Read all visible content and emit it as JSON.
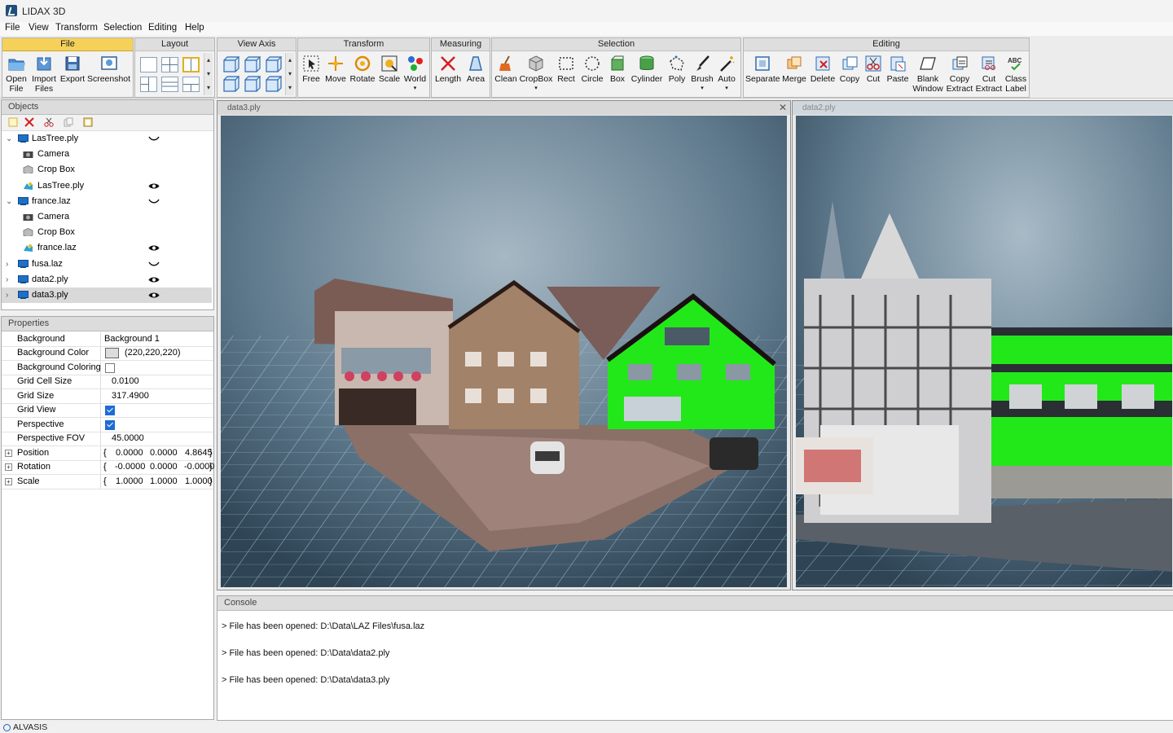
{
  "app": {
    "title": "LIDAX 3D",
    "status": "ALVASIS"
  },
  "menu": [
    "File",
    "View",
    "Transform",
    "Selection",
    "Editing",
    "Help"
  ],
  "ribbon": {
    "file": {
      "title": "File",
      "buttons": [
        {
          "l1": "Open",
          "l2": "File"
        },
        {
          "l1": "Import",
          "l2": "Files"
        },
        {
          "l1": "Export",
          "l2": ""
        },
        {
          "l1": "Screenshot",
          "l2": ""
        }
      ]
    },
    "layout": {
      "title": "Layout"
    },
    "view_axis": {
      "title": "View Axis"
    },
    "transform": {
      "title": "Transform",
      "buttons": [
        {
          "l1": "Free",
          "l2": ""
        },
        {
          "l1": "Move",
          "l2": ""
        },
        {
          "l1": "Rotate",
          "l2": ""
        },
        {
          "l1": "Scale",
          "l2": ""
        },
        {
          "l1": "World",
          "l2": ""
        }
      ]
    },
    "measuring": {
      "title": "Measuring",
      "buttons": [
        {
          "l1": "Length",
          "l2": ""
        },
        {
          "l1": "Area",
          "l2": ""
        }
      ]
    },
    "selection": {
      "title": "Selection",
      "buttons": [
        {
          "l1": "Clean",
          "l2": ""
        },
        {
          "l1": "CropBox",
          "l2": ""
        },
        {
          "l1": "Rect",
          "l2": ""
        },
        {
          "l1": "Circle",
          "l2": ""
        },
        {
          "l1": "Box",
          "l2": ""
        },
        {
          "l1": "Cylinder",
          "l2": ""
        },
        {
          "l1": "Poly",
          "l2": ""
        },
        {
          "l1": "Brush",
          "l2": ""
        },
        {
          "l1": "Auto",
          "l2": ""
        }
      ]
    },
    "editing": {
      "title": "Editing",
      "buttons": [
        {
          "l1": "Separate",
          "l2": ""
        },
        {
          "l1": "Merge",
          "l2": ""
        },
        {
          "l1": "Delete",
          "l2": ""
        },
        {
          "l1": "Copy",
          "l2": ""
        },
        {
          "l1": "Cut",
          "l2": ""
        },
        {
          "l1": "Paste",
          "l2": ""
        },
        {
          "l1": "Blank",
          "l2": "Window"
        },
        {
          "l1": "Copy",
          "l2": "Extract"
        },
        {
          "l1": "Cut",
          "l2": "Extract"
        },
        {
          "l1": "Class",
          "l2": "Label"
        }
      ]
    }
  },
  "objects": {
    "title": "Objects",
    "tree": [
      {
        "label": "LasTree.ply",
        "level": 0,
        "expanded": true,
        "icon": "cloud-file-icon",
        "eye": "closed"
      },
      {
        "label": "Camera",
        "level": 1,
        "icon": "camera-icon",
        "eye": ""
      },
      {
        "label": "Crop Box",
        "level": 1,
        "icon": "cube-icon",
        "eye": ""
      },
      {
        "label": "LasTree.ply",
        "level": 1,
        "icon": "pointcloud-icon",
        "eye": "open"
      },
      {
        "label": "france.laz",
        "level": 0,
        "expanded": true,
        "icon": "cloud-file-icon",
        "eye": "closed"
      },
      {
        "label": "Camera",
        "level": 1,
        "icon": "camera-icon",
        "eye": ""
      },
      {
        "label": "Crop Box",
        "level": 1,
        "icon": "cube-icon",
        "eye": ""
      },
      {
        "label": "france.laz",
        "level": 1,
        "icon": "pointcloud-icon",
        "eye": "open"
      },
      {
        "label": "fusa.laz",
        "level": 0,
        "expanded": false,
        "icon": "cloud-file-icon",
        "eye": "closed"
      },
      {
        "label": "data2.ply",
        "level": 0,
        "expanded": false,
        "icon": "cloud-file-icon",
        "eye": "open"
      },
      {
        "label": "data3.ply",
        "level": 0,
        "expanded": false,
        "icon": "cloud-file-icon",
        "eye": "open",
        "selected": true
      }
    ]
  },
  "properties": {
    "title": "Properties",
    "rows": [
      {
        "name": "Background",
        "value": "Background 1",
        "type": "text"
      },
      {
        "name": "Background Color",
        "value": "(220,220,220)",
        "type": "color",
        "swatch": "#dcdcdc"
      },
      {
        "name": "Background Coloring",
        "value": false,
        "type": "check"
      },
      {
        "name": "Grid Cell Size",
        "value": "0.0100",
        "type": "text"
      },
      {
        "name": "Grid Size",
        "value": "317.4900",
        "type": "text"
      },
      {
        "name": "Grid View",
        "value": true,
        "type": "check"
      },
      {
        "name": "Perspective",
        "value": true,
        "type": "check"
      },
      {
        "name": "Perspective FOV",
        "value": "45.0000",
        "type": "text"
      },
      {
        "name": "Position",
        "type": "vec",
        "v": [
          "0.0000",
          "0.0000",
          "4.8645"
        ]
      },
      {
        "name": "Rotation",
        "type": "vec",
        "v": [
          "-0.0000",
          "0.0000",
          "-0.0000"
        ]
      },
      {
        "name": "Scale",
        "type": "vec",
        "v": [
          "1.0000",
          "1.0000",
          "1.0000"
        ]
      }
    ]
  },
  "viewports": [
    {
      "tab": "data3.ply",
      "close": "✕"
    },
    {
      "tab": "data2.ply"
    }
  ],
  "console": {
    "title": "Console",
    "lines": [
      "> File has been opened: D:\\Data\\LAZ Files\\fusa.laz",
      "> File has been opened: D:\\Data\\data2.ply",
      "> File has been opened: D:\\Data\\data3.ply"
    ]
  },
  "colors": {
    "accent": "#f5d15a",
    "highlight_green": "#22e81a"
  }
}
